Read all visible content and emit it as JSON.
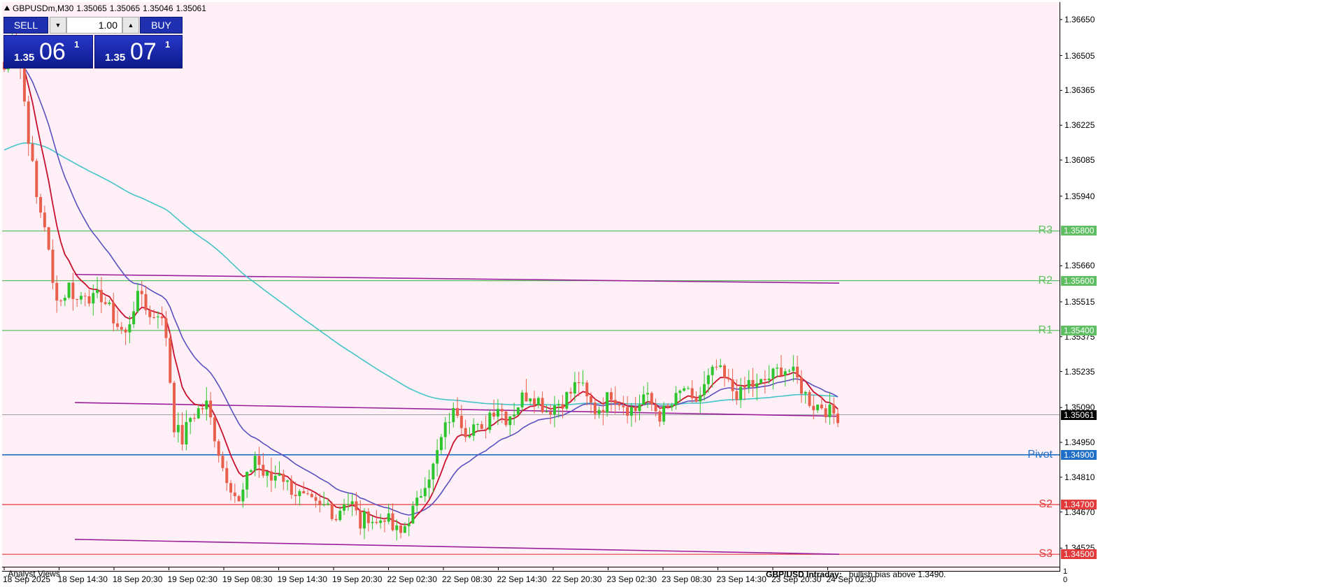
{
  "header": {
    "symbol_timeframe": "GBPUSDm,M30",
    "open": "1.35065",
    "high": "1.35065",
    "low": "1.35046",
    "close": "1.35061"
  },
  "trade_panel": {
    "sell_label": "SELL",
    "buy_label": "BUY",
    "lot_value": "1.00",
    "down_arrow": "▼",
    "up_arrow": "▲",
    "sell_price_prefix": "1.35",
    "sell_price_big": "06",
    "sell_price_sup": "1",
    "buy_price_prefix": "1.35",
    "buy_price_big": "07",
    "buy_price_sup": "1"
  },
  "indicator_window": {
    "label": ".Analyst Views",
    "analyst_title": "GBP/USD Intraday:",
    "analyst_text": "bullish bias above 1.3490.",
    "scale_top": "1",
    "scale_bottom": "0"
  },
  "colors": {
    "background": "#fef0f6",
    "bull": "#2ec52e",
    "bear": "#e8604c",
    "ema_fast": "#c8102e",
    "ema_mid": "#5a4fc0",
    "ema_slow": "#45c4c8",
    "envelope": "#9b1f9b",
    "resistance": "#5dbf62",
    "pivot": "#1f6fc8",
    "support": "#e33b3b",
    "price_line": "#9aa0a0"
  },
  "chart_data": {
    "type": "candlestick",
    "symbol": "GBPUSDm",
    "timeframe": "M30",
    "ylim": [
      1.3445,
      1.3672
    ],
    "y_ticks": [
      "1.36650",
      "1.36505",
      "1.36365",
      "1.36225",
      "1.36085",
      "1.35940",
      "1.35660",
      "1.35515",
      "1.35375",
      "1.35235",
      "1.35090",
      "1.34950",
      "1.34810",
      "1.34670",
      "1.34525"
    ],
    "x_ticks": [
      "18 Sep 2025",
      "18 Sep 14:30",
      "18 Sep 20:30",
      "19 Sep 02:30",
      "19 Sep 08:30",
      "19 Sep 14:30",
      "19 Sep 20:30",
      "22 Sep 02:30",
      "22 Sep 08:30",
      "22 Sep 14:30",
      "22 Sep 20:30",
      "23 Sep 02:30",
      "23 Sep 08:30",
      "23 Sep 14:30",
      "23 Sep 20:30",
      "24 Sep 02:30"
    ],
    "current_price": "1.35061",
    "levels": [
      {
        "name": "R3",
        "value": "1.35800",
        "kind": "resistance"
      },
      {
        "name": "R2",
        "value": "1.35600",
        "kind": "resistance"
      },
      {
        "name": "R1",
        "value": "1.35400",
        "kind": "resistance"
      },
      {
        "name": "Pivot",
        "value": "1.34900",
        "kind": "pivot"
      },
      {
        "name": "S2",
        "value": "1.34700",
        "kind": "support"
      },
      {
        "name": "S3",
        "value": "1.34500",
        "kind": "support"
      }
    ],
    "price_path": [
      1.3645,
      1.366,
      1.3646,
      1.3618,
      1.3593,
      1.3583,
      1.3558,
      1.3552,
      1.3558,
      1.3552,
      1.3556,
      1.3552,
      1.3554,
      1.3548,
      1.3542,
      1.3538,
      1.355,
      1.3555,
      1.3545,
      1.3548,
      1.3538,
      1.3502,
      1.3496,
      1.3505,
      1.3508,
      1.351,
      1.3498,
      1.3485,
      1.3478,
      1.347,
      1.348,
      1.349,
      1.3482,
      1.348,
      1.3484,
      1.3478,
      1.3475,
      1.3472,
      1.347,
      1.3468,
      1.347,
      1.3465,
      1.3472,
      1.347,
      1.3462,
      1.3466,
      1.3462,
      1.3466,
      1.346,
      1.3458,
      1.3465,
      1.347,
      1.348,
      1.3485,
      1.3496,
      1.3505,
      1.3508,
      1.35,
      1.3502,
      1.3498,
      1.3507,
      1.351,
      1.3505,
      1.3508,
      1.3513,
      1.3515,
      1.3512,
      1.3508,
      1.351,
      1.3512,
      1.3515,
      1.352,
      1.3512,
      1.3508,
      1.351,
      1.3515,
      1.3512,
      1.3509,
      1.3508,
      1.3514,
      1.351,
      1.3506,
      1.3508,
      1.3512,
      1.3517,
      1.351,
      1.3514,
      1.352,
      1.3525,
      1.352,
      1.3516,
      1.3514,
      1.3519,
      1.3517,
      1.352,
      1.3522,
      1.3525,
      1.3524,
      1.352,
      1.3514,
      1.351,
      1.351,
      1.3507,
      1.3506
    ]
  }
}
